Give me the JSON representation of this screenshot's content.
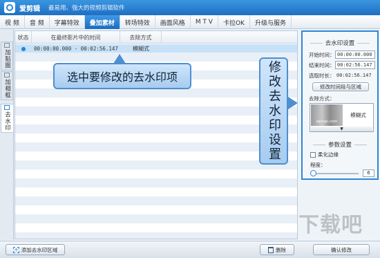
{
  "app": {
    "title": "爱剪辑",
    "slogan": "最易用、强大的视频剪辑软件"
  },
  "menu_tabs": [
    {
      "label": "视  频",
      "active": false
    },
    {
      "label": "音  频",
      "active": false
    },
    {
      "label": "字幕特效",
      "active": false
    },
    {
      "label": "叠加素材",
      "active": true
    },
    {
      "label": "转场特效",
      "active": false
    },
    {
      "label": "画面风格",
      "active": false
    },
    {
      "label": "M T V",
      "active": false
    },
    {
      "label": "卡拉OK",
      "active": false
    },
    {
      "label": "升级与服务",
      "active": false
    }
  ],
  "side_tabs": [
    {
      "label": "加贴图",
      "active": false
    },
    {
      "label": "加相框",
      "active": false
    },
    {
      "label": "去水印",
      "active": true
    }
  ],
  "list": {
    "headers": {
      "status": "状态",
      "time": "在最终影片中的时间",
      "method": "去除方式"
    },
    "rows": [
      {
        "status_icon": "●",
        "time": "00:00:00.000 - 00:02:56.147",
        "method": "模糊式"
      }
    ]
  },
  "callouts": {
    "select": "选中要修改的去水印项",
    "settings": "修改去水印设置"
  },
  "settings": {
    "section_title": "去水印设置",
    "start_label": "开始时间：",
    "start_value": "00:00:00.000",
    "end_label": "结束时间：",
    "end_value": "00:02:56.147",
    "duration_label": "选取时长：",
    "duration_value": "00:02:56.147",
    "modify_button": "修改时间段与区域",
    "method_label": "去除方式：",
    "method_thumb_caption": "sjisnpl.com",
    "method_name": "模糊式",
    "dropdown_arrow": "▼",
    "params_title": "参数设置",
    "soften_label": "柔化边缘",
    "soften_checked": false,
    "degree_label": "程度：",
    "degree_value": "6",
    "degree_fraction": 0.05
  },
  "bottom": {
    "add_button": "添加去水印区域",
    "add_icon": "+",
    "delete_button": "删除",
    "confirm_button": "确认修改"
  },
  "watermark_text": "下载吧",
  "colors": {
    "accent": "#2a85d8",
    "active_tab": "#1c6cc0"
  }
}
